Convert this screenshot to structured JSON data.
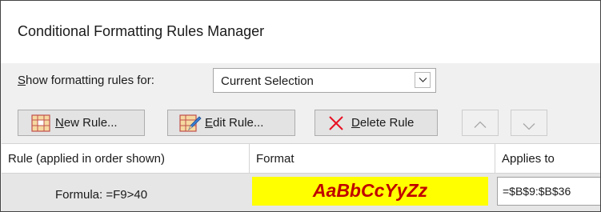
{
  "dialog": {
    "title": "Conditional Formatting Rules Manager"
  },
  "show_rules": {
    "label_underlined": "S",
    "label_rest": "how formatting rules for:",
    "selected": "Current Selection"
  },
  "toolbar": {
    "new_rule_ul": "N",
    "new_rule_rest": "ew Rule...",
    "edit_rule_ul": "E",
    "edit_rule_rest": "dit Rule...",
    "delete_rule_ul": "D",
    "delete_rule_rest": "elete Rule"
  },
  "table": {
    "headers": [
      "Rule (applied in order shown)",
      "Format",
      "Applies to"
    ],
    "rows": [
      {
        "rule": "Formula: =F9>40",
        "format_preview": "AaBbCcYyZz",
        "applies_to": "=$B$9:$B$36"
      }
    ]
  },
  "colors": {
    "preview_fill": "#ffff00",
    "preview_text": "#c00000",
    "delete_icon": "#e81123"
  },
  "icons": [
    "new-rule-icon",
    "edit-rule-icon",
    "delete-icon",
    "move-up-icon",
    "move-down-icon",
    "chevron-down-icon"
  ]
}
